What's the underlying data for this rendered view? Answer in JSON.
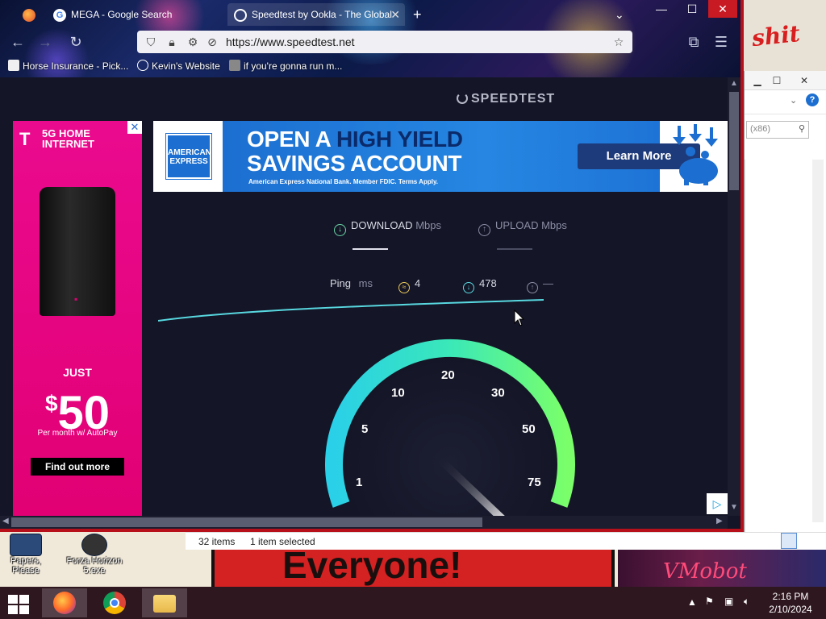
{
  "browser": {
    "tabs": [
      {
        "title": "MEGA - Google Search",
        "active": false
      },
      {
        "title": "Speedtest by Ookla - The Global",
        "active": true
      }
    ],
    "new_tab": "+",
    "url": "https://www.speedtest.net",
    "bookmarks": [
      {
        "label": "Horse Insurance - Pick..."
      },
      {
        "label": "Kevin's Website"
      },
      {
        "label": "if you're gonna run m..."
      }
    ]
  },
  "speedtest": {
    "logo": "SPEEDTEST",
    "download_label": "DOWNLOAD",
    "download_unit": "Mbps",
    "upload_label": "UPLOAD",
    "upload_unit": "Mbps",
    "ping_label": "Ping",
    "ping_unit": "ms",
    "idle_ping": "4",
    "download_ping": "478",
    "upload_ping": "—",
    "gauge_ticks": [
      "1",
      "5",
      "10",
      "20",
      "30",
      "50",
      "75"
    ]
  },
  "ads": {
    "tmobile": {
      "logo": "T",
      "headline": "5G HOME INTERNET",
      "just": "JUST",
      "price_symbol": "$",
      "price": "50",
      "sub": "Per month w/ AutoPay",
      "cta": "Find out more"
    },
    "amex": {
      "logo_line1": "AMERICAN",
      "logo_line2": "EXPRESS",
      "headline_1a": "OPEN A ",
      "headline_1b": "HIGH YIELD",
      "headline_2": "SAVINGS ACCOUNT",
      "fine_print": "American Express National Bank. Member FDIC. Terms Apply.",
      "cta": "Learn More"
    }
  },
  "explorer": {
    "search_placeholder": "(x86)",
    "items_count": "32 items",
    "selected": "1 item selected"
  },
  "desktop": {
    "icons": [
      {
        "label": "Papers, Please"
      },
      {
        "label": "Forza Horizon 5.exe"
      }
    ],
    "wallpaper_text_1": "Everyone!",
    "wallpaper_text_2": "shit",
    "wallpaper_text_3": "VMobot"
  },
  "taskbar": {
    "time": "2:16 PM",
    "date": "2/10/2024"
  },
  "colors": {
    "speedtest_bg": "#141526",
    "accent_cyan": "#58d8e0",
    "accent_green": "#6bff6b",
    "tmobile_magenta": "#e20074",
    "amex_blue": "#1c6fd0",
    "window_border": "#b8101a"
  }
}
